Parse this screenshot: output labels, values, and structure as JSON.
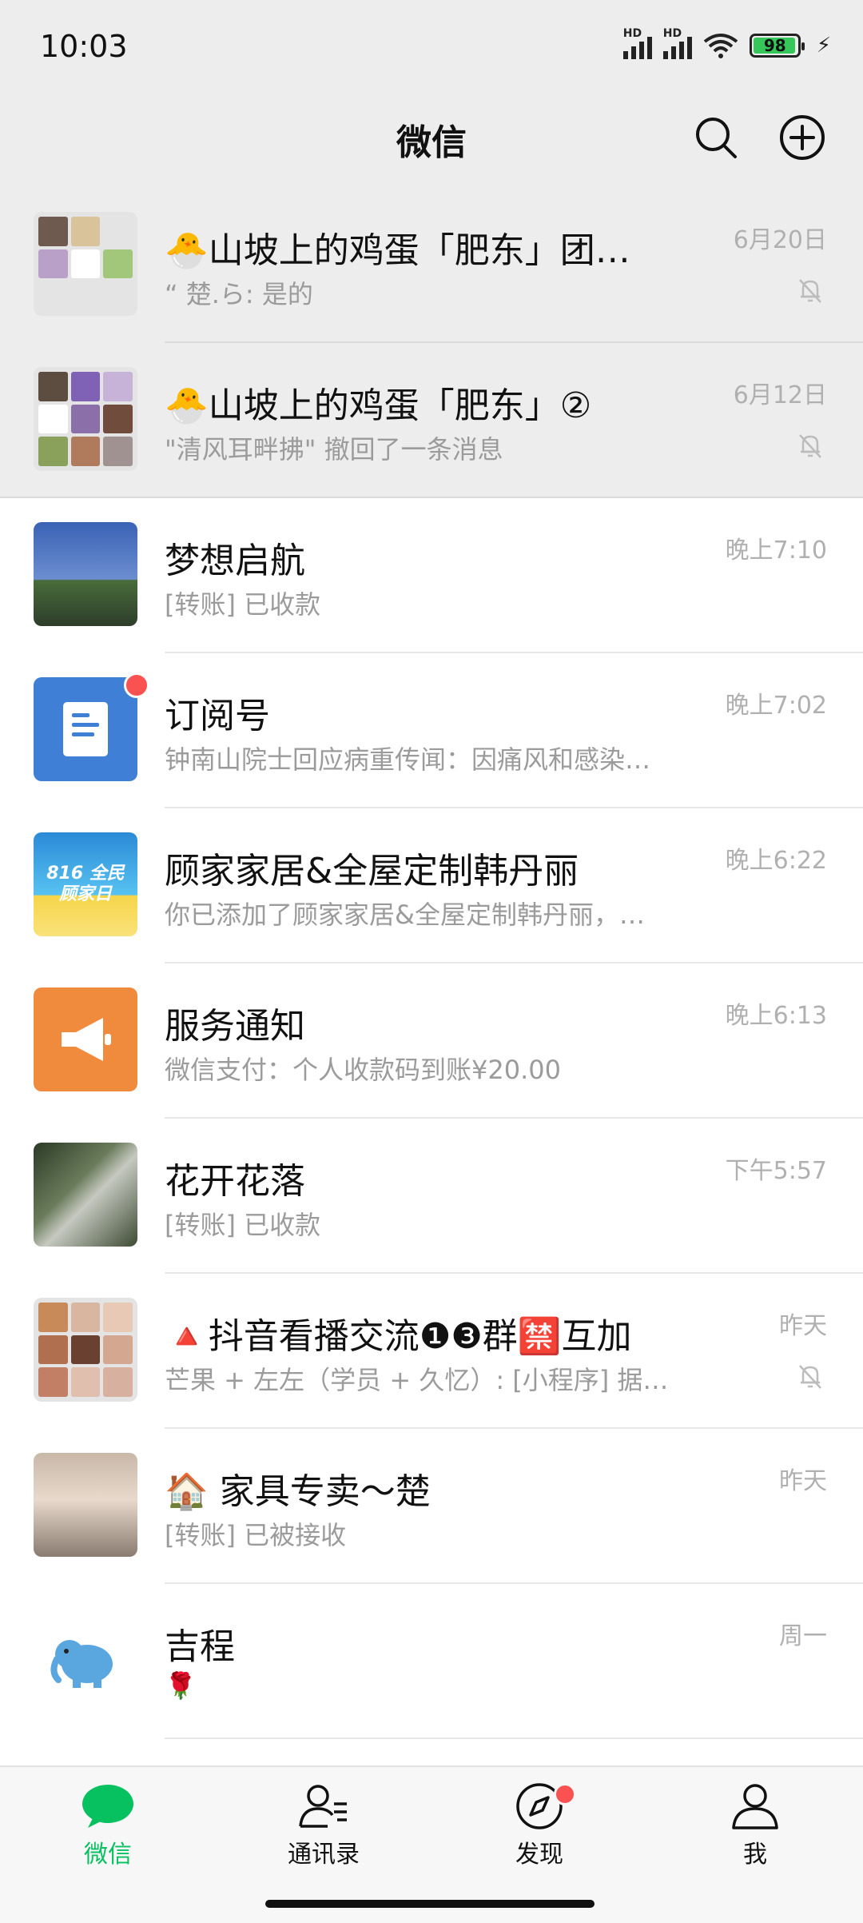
{
  "status": {
    "time": "10:03",
    "battery": "98",
    "signal_label": "HD"
  },
  "header": {
    "title": "微信"
  },
  "chats": [
    {
      "name": "🐣山坡上的鸡蛋「肥东」团…",
      "preview": "“ 楚.ら: 是的",
      "time": "6月20日",
      "muted": true,
      "pinned": true
    },
    {
      "name": "🐣山坡上的鸡蛋「肥东」②",
      "preview": "\"清风耳畔拂\" 撤回了一条消息",
      "time": "6月12日",
      "muted": true,
      "pinned": true
    },
    {
      "name": "梦想启航",
      "preview": "[转账] 已收款",
      "time": "晚上7:10"
    },
    {
      "name": "订阅号",
      "preview": "钟南山院士回应病重传闻：因痛风和感染…",
      "time": "晚上7:02",
      "unread_dot": true
    },
    {
      "name": "顾家家居&全屋定制韩丹丽",
      "preview": "你已添加了顾家家居&全屋定制韩丹丽，…",
      "time": "晚上6:22",
      "avatar_text": "816 全民顾家日"
    },
    {
      "name": "服务通知",
      "preview": "微信支付：个人收款码到账¥20.00",
      "time": "晚上6:13"
    },
    {
      "name": "花开花落",
      "preview": "[转账] 已收款",
      "time": "下午5:57"
    },
    {
      "name": "🔺抖音看播交流❶❸群🈲互加",
      "preview": "芒果 + 左左（学员 + 久忆）: [小程序] 据…",
      "time": "昨天",
      "muted": true
    },
    {
      "name": "🏠 家具专卖～楚",
      "preview": "[转账] 已被接收",
      "time": "昨天"
    },
    {
      "name": "吉程",
      "preview": "🌹",
      "time": "周一"
    }
  ],
  "tabs": [
    {
      "label": "微信",
      "active": true
    },
    {
      "label": "通讯录"
    },
    {
      "label": "发现",
      "dot": true
    },
    {
      "label": "我"
    }
  ],
  "colors": {
    "accent": "#07c160",
    "badge": "#fa5151",
    "header_bg": "#ededed"
  }
}
